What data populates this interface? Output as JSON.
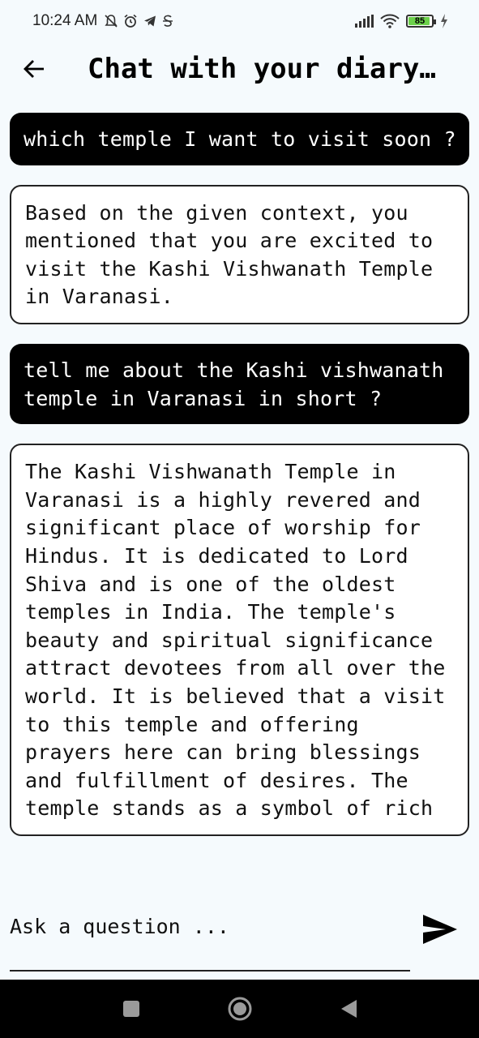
{
  "status_bar": {
    "time": "10:24 AM",
    "battery_level": "85",
    "battery_color": "#6cd04a",
    "icons": [
      "mute-icon",
      "alarm-icon",
      "telegram-icon",
      "sync-icon",
      "signal-icon",
      "wifi-icon",
      "charging-icon"
    ]
  },
  "app_bar": {
    "title": "Chat with your diary …",
    "back_icon": "arrow-left-icon"
  },
  "messages": [
    {
      "role": "user",
      "text": "which temple I want to visit soon ?"
    },
    {
      "role": "bot",
      "text": "Based on the given context, you mentioned that you are excited to visit the Kashi Vishwanath Temple in Varanasi."
    },
    {
      "role": "user",
      "text": "tell me about the Kashi vishwanath temple in Varanasi in short ?"
    },
    {
      "role": "bot",
      "text": "The Kashi Vishwanath Temple in Varanasi is a highly revered and significant place of worship for Hindus. It is dedicated to Lord Shiva and is one of the oldest temples in India. The temple's beauty and spiritual significance attract devotees from all over the world. It is believed that a visit to this temple and offering prayers here can bring blessings and fulfillment of desires. The temple stands as a symbol of rich"
    }
  ],
  "input": {
    "placeholder": "Ask a question ...",
    "value": "",
    "send_icon": "send-icon"
  },
  "nav_bar": {
    "buttons": [
      "recents-icon",
      "home-icon",
      "back-triangle-icon"
    ]
  }
}
